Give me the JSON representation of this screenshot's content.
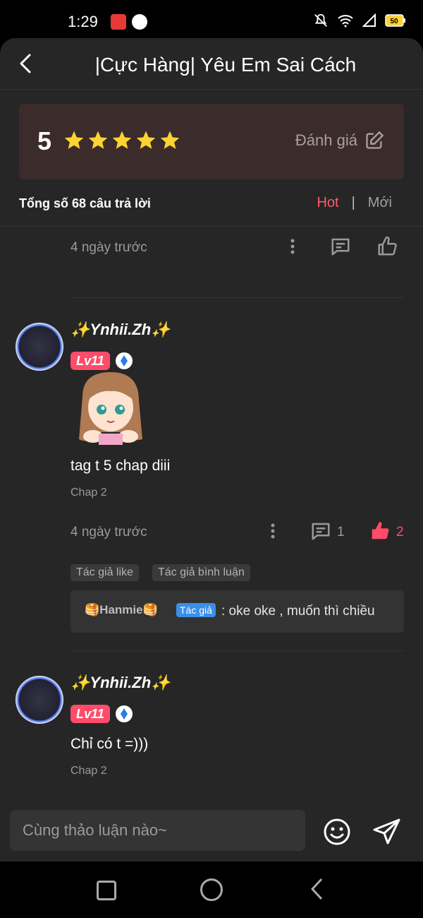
{
  "status_bar": {
    "time": "1:29",
    "battery": "50"
  },
  "header": {
    "title": "|Cực Hàng| Yêu Em Sai Cách"
  },
  "rating": {
    "score": "5",
    "stars": 5,
    "action_label": "Đánh giá"
  },
  "summary": {
    "total_text": "Tổng số 68 câu trả lời"
  },
  "sort": {
    "hot": "Hot",
    "separator": "|",
    "new": "Mới"
  },
  "comments": [
    {
      "time_ago": "4 ngày trước"
    },
    {
      "username": "✨Ynhii.Zh✨",
      "level": "Lv11",
      "text": "tag t 5 chap diii",
      "chap": "Chap 2",
      "time_ago": "4 ngày trước",
      "reply_count": "1",
      "like_count": "2",
      "tags": [
        "Tác giả like",
        "Tác giả bình luận"
      ],
      "reply": {
        "user": "🥞Hanmie🥞",
        "badge": "Tác giả",
        "text": ": oke oke , muốn thì chiều"
      }
    },
    {
      "username": "✨Ynhii.Zh✨",
      "level": "Lv11",
      "text": "Chỉ có t =)))",
      "chap": "Chap 2"
    }
  ],
  "input": {
    "placeholder": "Cùng thảo luận nào~"
  },
  "colors": {
    "accent": "#ff4c6a",
    "star": "#ffd233",
    "panel": "#262626",
    "author_badge": "#3a8fe8"
  },
  "icons": [
    "back-icon",
    "star-icon",
    "edit-icon",
    "more-icon",
    "comment-icon",
    "like-icon",
    "emoji-icon",
    "send-icon"
  ]
}
